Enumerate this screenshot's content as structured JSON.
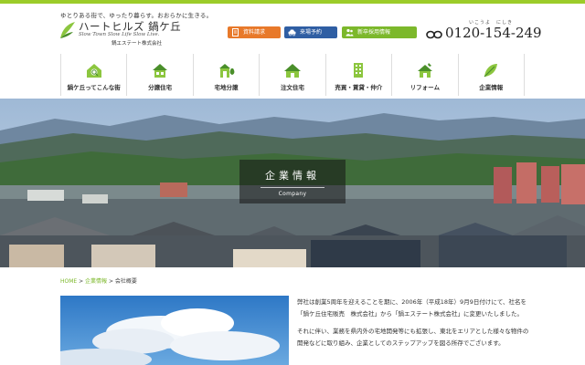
{
  "header": {
    "tagline": "ゆとりある街で、ゆったり暮らす。おおらかに生きる。",
    "logo_name": "ハートヒルズ 鍋ケ丘",
    "logo_sub": "Slow Town Slow Life Slow Live.",
    "logo_corp": "鍋エステート株式会社",
    "buttons": {
      "docs": "資料請求",
      "visit": "来場予約",
      "recruit": "新卒採用情報"
    },
    "phone_ruby": "いこうよ　にしき",
    "phone_number": "0120-154-249"
  },
  "nav": [
    {
      "label": "鍋ケ丘ってこんな街",
      "icon": "town-search-icon"
    },
    {
      "label": "分譲住宅",
      "icon": "house-icon"
    },
    {
      "label": "宅地分譲",
      "icon": "land-plot-icon"
    },
    {
      "label": "注文住宅",
      "icon": "custom-house-icon"
    },
    {
      "label": "売買・賃貸・仲介",
      "icon": "building-icon"
    },
    {
      "label": "リフォーム",
      "icon": "renovation-icon"
    },
    {
      "label": "企業情報",
      "icon": "company-leaf-icon"
    }
  ],
  "hero": {
    "title": "企業情報",
    "subtitle": "Company"
  },
  "breadcrumb": {
    "home": "HOME",
    "sep1": " > ",
    "section": "企業情報",
    "sep2": " > ",
    "current": "会社概要"
  },
  "content": {
    "para1": "弊社は創業5周年を迎えることを期に、2006年（平成18年）9月9日付けにて、社名を「鍋ケ丘住宅販売　株式会社」から「鍋エステート株式会社」に変更いたしました。",
    "para2": "それに伴い、業務を県内外の宅地開発等にも拡張し、東北をエリアとした様々な物件の開発などに取り組み、企業としてのステップアップを図る所存でございます。"
  },
  "colors": {
    "accent_green": "#9ccc2a",
    "orange": "#e8792a",
    "blue": "#2f5ea3",
    "green": "#7cb82b"
  }
}
